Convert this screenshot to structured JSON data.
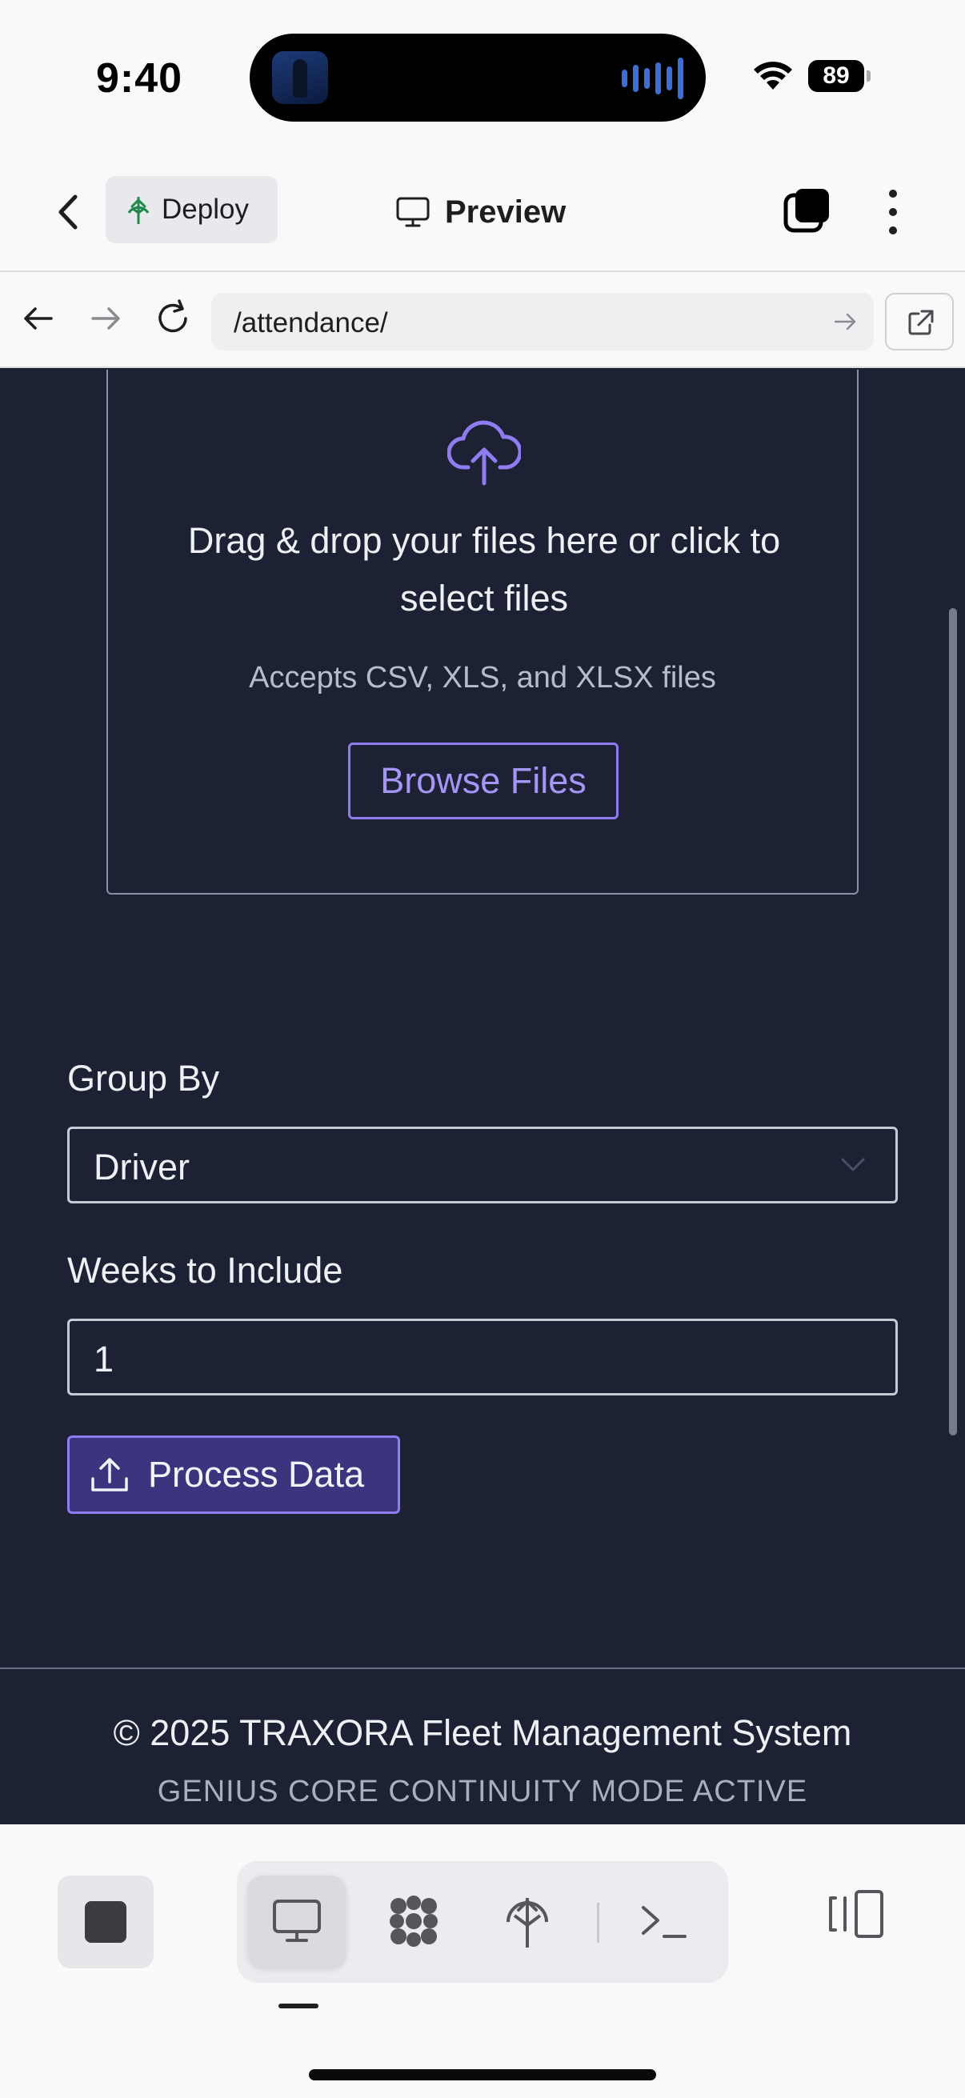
{
  "status_bar": {
    "time": "9:40",
    "battery": "89"
  },
  "header": {
    "deploy_label": "Deploy",
    "title": "Preview"
  },
  "browser": {
    "url": "/attendance/"
  },
  "upload": {
    "prompt": "Drag & drop your files here or click to select files",
    "accepts": "Accepts CSV, XLS, and XLSX files",
    "browse_label": "Browse Files"
  },
  "form": {
    "group_by_label": "Group By",
    "group_by_value": "Driver",
    "weeks_label": "Weeks to Include",
    "weeks_value": "1",
    "process_label": "Process Data"
  },
  "footer": {
    "copyright": "© 2025 TRAXORA Fleet Management System",
    "mode": "GENIUS CORE CONTINUITY MODE ACTIVE"
  },
  "colors": {
    "accent": "#8e7cf0",
    "background": "#1c2234",
    "deploy_icon": "#1f8a4c"
  },
  "toolbar": {
    "icons": [
      "stop-icon",
      "desktop-icon",
      "apps-icon",
      "deploy-icon",
      "terminal-icon",
      "layout-icon"
    ]
  }
}
